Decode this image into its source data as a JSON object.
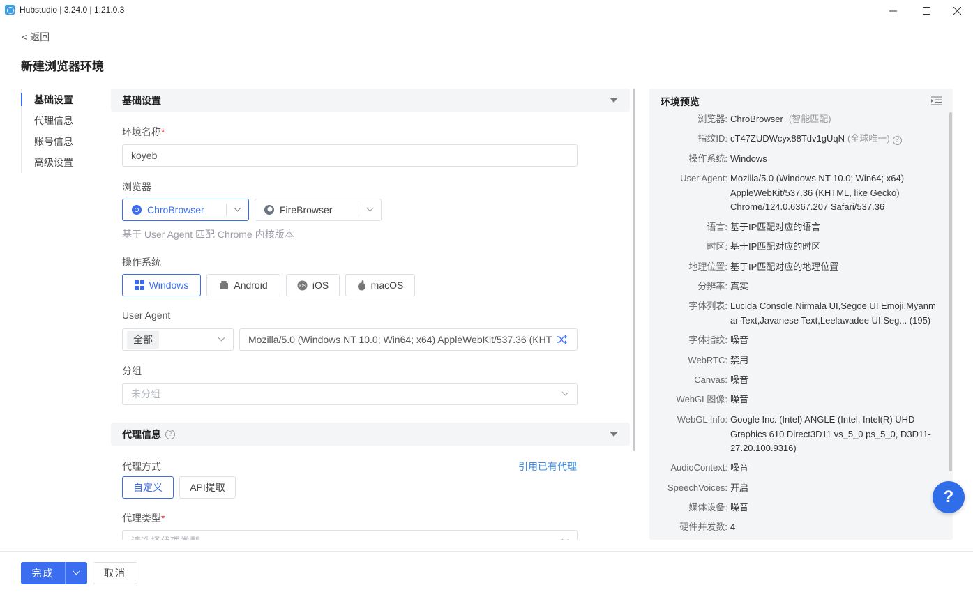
{
  "window": {
    "title": "Hubstudio | 3.24.0 | 1.21.0.3"
  },
  "nav": {
    "back": "< 返回"
  },
  "page": {
    "title": "新建浏览器环境"
  },
  "sidebar": {
    "items": [
      "基础设置",
      "代理信息",
      "账号信息",
      "高级设置"
    ]
  },
  "basic": {
    "section_title": "基础设置",
    "env_name_label": "环境名称",
    "env_name_value": "koyeb",
    "browser_label": "浏览器",
    "browser_options": [
      "ChroBrowser",
      "FireBrowser"
    ],
    "browser_hint": "基于 User Agent 匹配 Chrome 内核版本",
    "os_label": "操作系统",
    "os_options": [
      "Windows",
      "Android",
      "iOS",
      "macOS"
    ],
    "ua_label": "User Agent",
    "ua_filter_tag": "全部",
    "ua_value": "Mozilla/5.0 (Windows NT 10.0; Win64; x64) AppleWebKit/537.36 (KHT",
    "group_label": "分组",
    "group_placeholder": "未分组"
  },
  "proxy": {
    "section_title": "代理信息",
    "mode_label": "代理方式",
    "use_existing_link": "引用已有代理",
    "mode_options": [
      "自定义",
      "API提取"
    ],
    "type_label": "代理类型",
    "type_placeholder": "请选择代理类型"
  },
  "preview": {
    "title": "环境预览",
    "rows": [
      {
        "key": "浏览器:",
        "value": "ChroBrowser",
        "note": "(智能匹配)"
      },
      {
        "key": "指纹ID:",
        "value": "cT47ZUDWcyx88Tdv1gUqN",
        "note": "(全球唯一)"
      },
      {
        "key": "操作系统:",
        "value": "Windows"
      },
      {
        "key": "User Agent:",
        "value": "Mozilla/5.0 (Windows NT 10.0; Win64; x64) AppleWebKit/537.36 (KHTML, like Gecko) Chrome/124.0.6367.207 Safari/537.36"
      },
      {
        "key": "语言:",
        "value": "基于IP匹配对应的语言"
      },
      {
        "key": "时区:",
        "value": "基于IP匹配对应的时区"
      },
      {
        "key": "地理位置:",
        "value": "基于IP匹配对应的地理位置"
      },
      {
        "key": "分辨率:",
        "value": "真实"
      },
      {
        "key": "字体列表:",
        "value": "Lucida Console,Nirmala UI,Segoe UI Emoji,Myanmar Text,Javanese Text,Leelawadee UI,Seg...  (195)"
      },
      {
        "key": "字体指纹:",
        "value": "噪音"
      },
      {
        "key": "WebRTC:",
        "value": "禁用"
      },
      {
        "key": "Canvas:",
        "value": "噪音"
      },
      {
        "key": "WebGL图像:",
        "value": "噪音"
      },
      {
        "key": "WebGL Info:",
        "value": "Google Inc. (Intel) ANGLE (Intel, Intel(R) UHD Graphics 610 Direct3D11 vs_5_0 ps_5_0, D3D11-27.20.100.9316)"
      },
      {
        "key": "AudioContext:",
        "value": "噪音"
      },
      {
        "key": "SpeechVoices:",
        "value": "开启"
      },
      {
        "key": "媒体设备:",
        "value": "噪音"
      },
      {
        "key": "硬件并发数:",
        "value": "4"
      }
    ]
  },
  "help": {
    "label": "?"
  },
  "footer": {
    "done": "完成",
    "cancel": "取消"
  }
}
